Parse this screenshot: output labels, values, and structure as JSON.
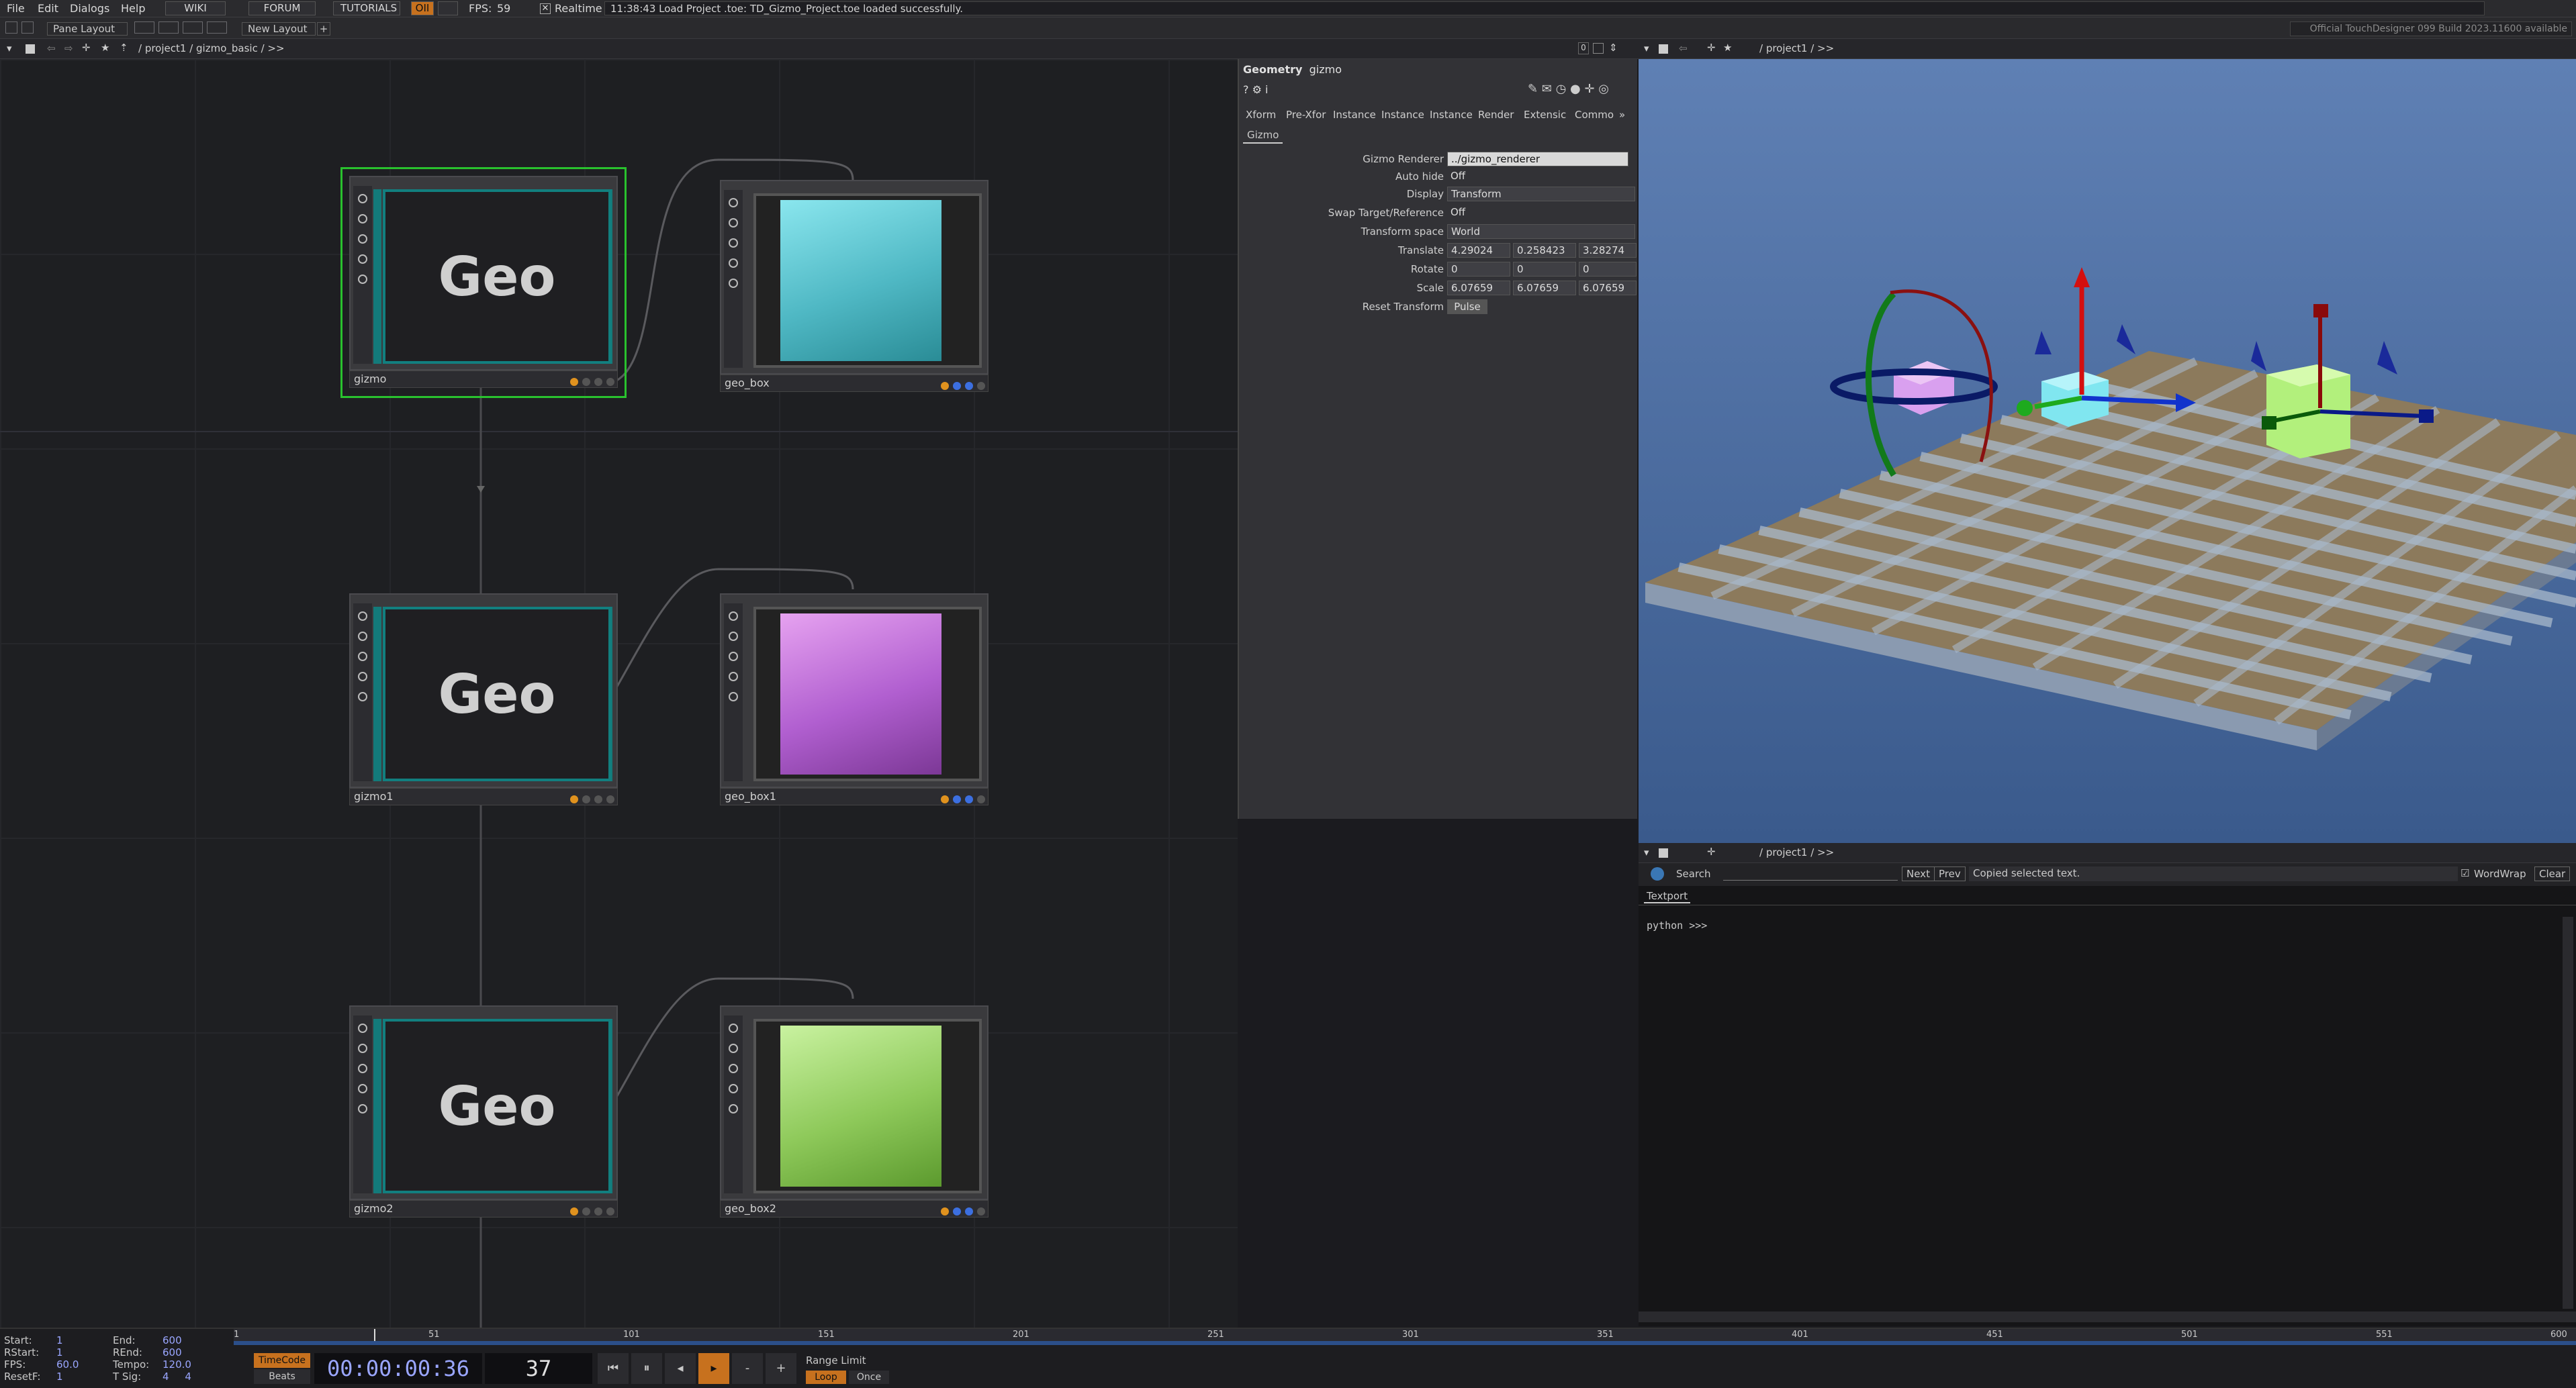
{
  "menu": {
    "items": [
      "File",
      "Edit",
      "Dialogs",
      "Help"
    ],
    "buttons": [
      "WIKI",
      "FORUM",
      "TUTORIALS"
    ],
    "oii": "OII",
    "fps_label": "FPS:",
    "fps_value": "59",
    "realtime_label": "Realtime",
    "status_message": "11:38:43 Load Project .toe: TD_Gizmo_Project.toe loaded successfully."
  },
  "toolbar": {
    "pane_layout": "Pane Layout",
    "new_layout": "New Layout",
    "build_info": "Official TouchDesigner 099 Build 2023.11600 available"
  },
  "network_editor": {
    "path": "/ project1 / gizmo_basic / >>",
    "nodes": [
      {
        "name": "gizmo",
        "text": "Geo"
      },
      {
        "name": "geo_box",
        "color": "#4fb8c4"
      },
      {
        "name": "gizmo1",
        "text": "Geo"
      },
      {
        "name": "geo_box1",
        "color": "#b15fd0"
      },
      {
        "name": "gizmo2",
        "text": "Geo"
      },
      {
        "name": "geo_box2",
        "color": "#8ec95a"
      }
    ]
  },
  "parameters": {
    "op_type": "Geometry",
    "op_name": "gizmo",
    "tabs": [
      "Xform",
      "Pre-Xfor",
      "Instance",
      "Instance",
      "Instance",
      "Render",
      "Extensic",
      "Commo"
    ],
    "page": "Gizmo",
    "rows": [
      {
        "label": "Gizmo Renderer",
        "values": [
          "../gizmo_renderer"
        ]
      },
      {
        "label": "Auto hide",
        "values": [
          "Off"
        ]
      },
      {
        "label": "Display",
        "values": [
          "Transform"
        ]
      },
      {
        "label": "Swap Target/Reference",
        "values": [
          "Off"
        ]
      },
      {
        "label": "Transform space",
        "values": [
          "World"
        ]
      },
      {
        "label": "Translate",
        "values": [
          "4.29024",
          "0.258423",
          "3.28274"
        ]
      },
      {
        "label": "Rotate",
        "values": [
          "0",
          "0",
          "0"
        ]
      },
      {
        "label": "Scale",
        "values": [
          "6.07659",
          "6.07659",
          "6.07659"
        ]
      },
      {
        "label": "Reset Transform",
        "values": [
          "Pulse"
        ]
      }
    ]
  },
  "viewer": {
    "path": "/ project1 / >>"
  },
  "textport": {
    "path": "/ project1 / >>",
    "search_label": "Search",
    "next": "Next",
    "prev": "Prev",
    "status": "Copied selected text.",
    "wordwrap": "WordWrap",
    "clear": "Clear",
    "tab": "Textport",
    "prompt": "python >>>"
  },
  "timeline": {
    "stats": [
      {
        "label": "Start:",
        "value": "1"
      },
      {
        "label": "RStart:",
        "value": "1"
      },
      {
        "label": "FPS:",
        "value": "60.0"
      },
      {
        "label": "ResetF:",
        "value": "1"
      }
    ],
    "stats2": [
      {
        "label": "End:",
        "value": "600"
      },
      {
        "label": "REnd:",
        "value": "600"
      },
      {
        "label": "Tempo:",
        "value": "120.0"
      },
      {
        "label": "T Sig:",
        "value": "4     4"
      }
    ],
    "ruler": [
      "1",
      "51",
      "101",
      "151",
      "201",
      "251",
      "301",
      "351",
      "401",
      "451",
      "501",
      "551",
      "600"
    ],
    "timecode_label": "TimeCode",
    "beats_label": "Beats",
    "timecode": "00:00:00:36",
    "frame": "37",
    "range_limit": "Range Limit",
    "loop": "Loop",
    "once": "Once",
    "playhead_fraction": 0.06
  }
}
